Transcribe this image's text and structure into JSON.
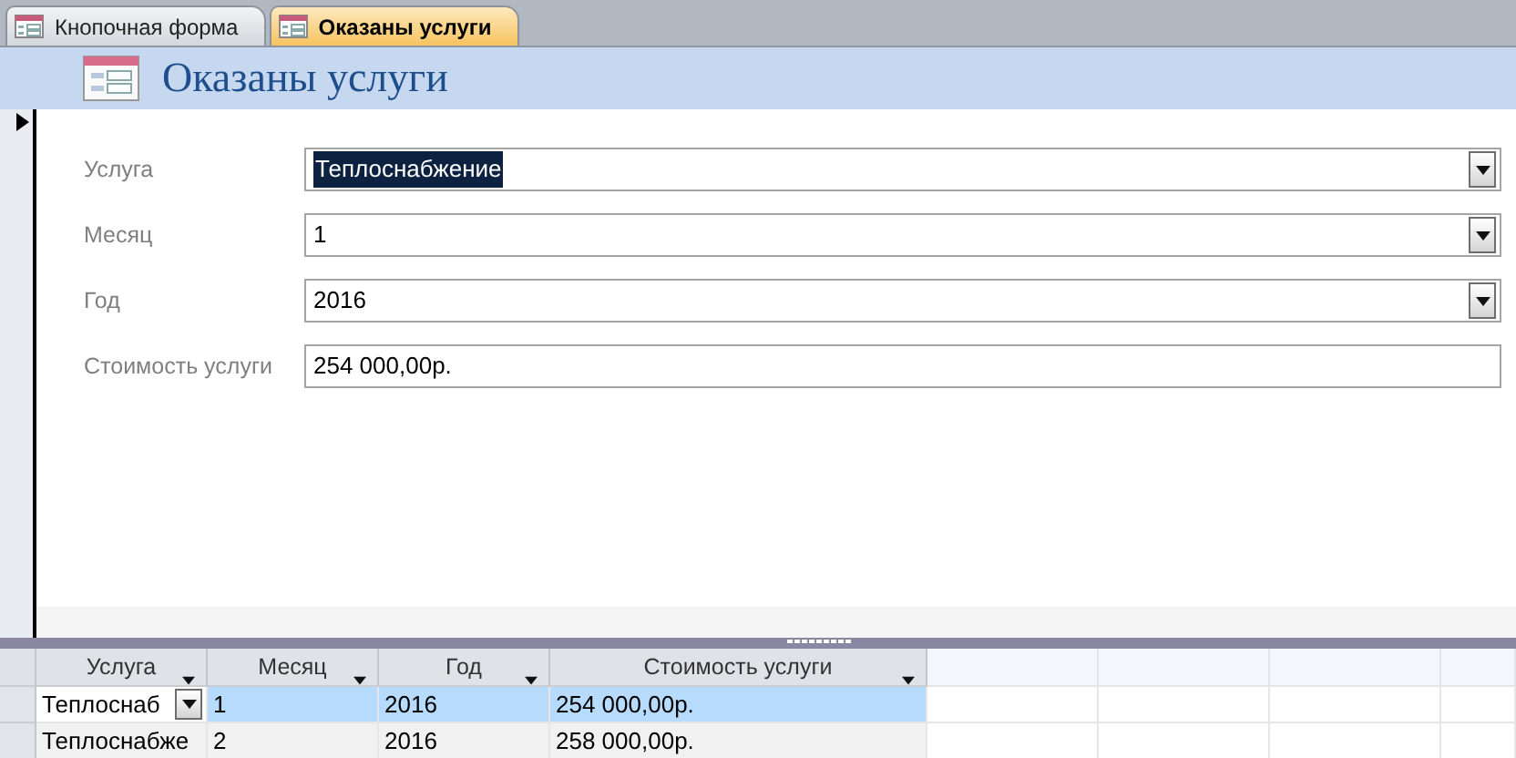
{
  "tabs": [
    {
      "label": "Кнопочная форма",
      "selected": false
    },
    {
      "label": "Оказаны услуги",
      "selected": true
    }
  ],
  "form": {
    "title": "Оказаны услуги",
    "fields": [
      {
        "kind": "combo",
        "label": "Услуга",
        "value": "Теплоснабжение",
        "highlighted": true
      },
      {
        "kind": "combo",
        "label": "Месяц",
        "value": "1",
        "highlighted": false
      },
      {
        "kind": "combo",
        "label": "Год",
        "value": "2016",
        "highlighted": false
      },
      {
        "kind": "text",
        "label": "Стоимость услуги",
        "value": "254 000,00р.",
        "highlighted": false
      }
    ]
  },
  "datasheet": {
    "columns": [
      "Услуга",
      "Месяц",
      "Год",
      "Стоимость услуги"
    ],
    "rows": [
      {
        "selected": true,
        "cells": [
          "Теплоснаб",
          "1",
          "2016",
          "254 000,00р."
        ]
      },
      {
        "selected": false,
        "cells": [
          "Теплоснабже",
          "2",
          "2016",
          "258 000,00р."
        ]
      }
    ]
  }
}
